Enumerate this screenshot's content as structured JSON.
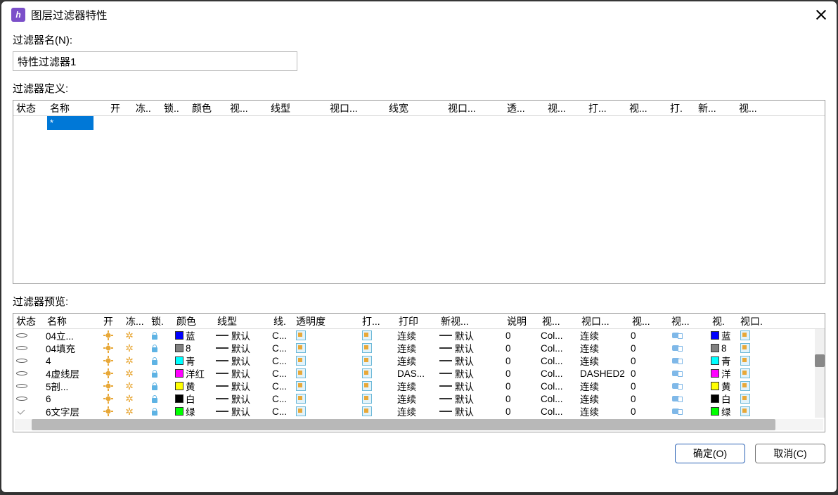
{
  "window": {
    "title": "图层过滤器特性"
  },
  "filter_name": {
    "label": "过滤器名(N):",
    "value": "特性过滤器1"
  },
  "filter_def": {
    "label": "过滤器定义:",
    "columns": [
      "状态",
      "名称",
      "开",
      "冻..",
      "锁..",
      "颜色",
      "视...",
      "线型",
      "视口...",
      "线宽",
      "视口...",
      "透...",
      "视...",
      "打...",
      "视...",
      "打.",
      "新...",
      "视..."
    ],
    "widths": [
      48,
      86,
      36,
      40,
      40,
      54,
      58,
      84,
      84,
      84,
      84,
      58,
      58,
      58,
      58,
      40,
      58,
      60
    ],
    "filter_value": "*"
  },
  "preview": {
    "label": "过滤器预览:",
    "columns": [
      "状态",
      "名称",
      "开",
      "冻...",
      "锁.",
      "颜色",
      "线型",
      "线.",
      "透明度",
      "打...",
      "打印",
      "新视...",
      "说明",
      "视...",
      "视口...",
      "视...",
      "视...",
      "视.",
      "视口."
    ],
    "widths": [
      44,
      80,
      32,
      36,
      36,
      58,
      80,
      32,
      94,
      52,
      60,
      94,
      50,
      56,
      72,
      56,
      58,
      40,
      38
    ],
    "rows": [
      {
        "status": "ellipse",
        "name": "04立...",
        "color_sw": "#0000ff",
        "color": "蓝",
        "linetype": "默认",
        "lt2": "C...",
        "print": "连续",
        "newvp": "默认",
        "transp": "0",
        "vp1": "Col...",
        "vp2": "连续",
        "vp3": "0",
        "vp_sw": "#0000ff",
        "vp_col": "蓝"
      },
      {
        "status": "ellipse",
        "name": "04填充",
        "color_sw": "#808080",
        "color": "8",
        "linetype": "默认",
        "lt2": "C...",
        "print": "连续",
        "newvp": "默认",
        "transp": "0",
        "vp1": "Col...",
        "vp2": "连续",
        "vp3": "0",
        "vp_sw": "#808080",
        "vp_col": "8"
      },
      {
        "status": "ellipse",
        "name": "4",
        "color_sw": "#00ffff",
        "color": "青",
        "linetype": "默认",
        "lt2": "C...",
        "print": "连续",
        "newvp": "默认",
        "transp": "0",
        "vp1": "Col...",
        "vp2": "连续",
        "vp3": "0",
        "vp_sw": "#00ffff",
        "vp_col": "青"
      },
      {
        "status": "ellipse",
        "name": "4虚线层",
        "color_sw": "#ff00ff",
        "color": "洋红",
        "linetype": "默认",
        "lt2": "C...",
        "print": "DAS...",
        "newvp": "默认",
        "transp": "0",
        "vp1": "Col...",
        "vp2": "DASHED2",
        "vp3": "0",
        "vp_sw": "#ff00ff",
        "vp_col": "洋"
      },
      {
        "status": "ellipse",
        "name": "5剖...",
        "color_sw": "#ffff00",
        "color": "黄",
        "linetype": "默认",
        "lt2": "C...",
        "print": "连续",
        "newvp": "默认",
        "transp": "0",
        "vp1": "Col...",
        "vp2": "连续",
        "vp3": "0",
        "vp_sw": "#ffff00",
        "vp_col": "黄"
      },
      {
        "status": "ellipse",
        "name": "6",
        "color_sw": "#000000",
        "color": "白",
        "linetype": "默认",
        "lt2": "C...",
        "print": "连续",
        "newvp": "默认",
        "transp": "0",
        "vp1": "Col...",
        "vp2": "连续",
        "vp3": "0",
        "vp_sw": "#000000",
        "vp_col": "白"
      },
      {
        "status": "check",
        "name": "6文字层",
        "color_sw": "#00ff00",
        "color": "绿",
        "linetype": "默认",
        "lt2": "C...",
        "print": "连续",
        "newvp": "默认",
        "transp": "0",
        "vp1": "Col...",
        "vp2": "连续",
        "vp3": "0",
        "vp_sw": "#00ff00",
        "vp_col": "绿"
      }
    ]
  },
  "buttons": {
    "ok": "确定(O)",
    "cancel": "取消(C)"
  }
}
